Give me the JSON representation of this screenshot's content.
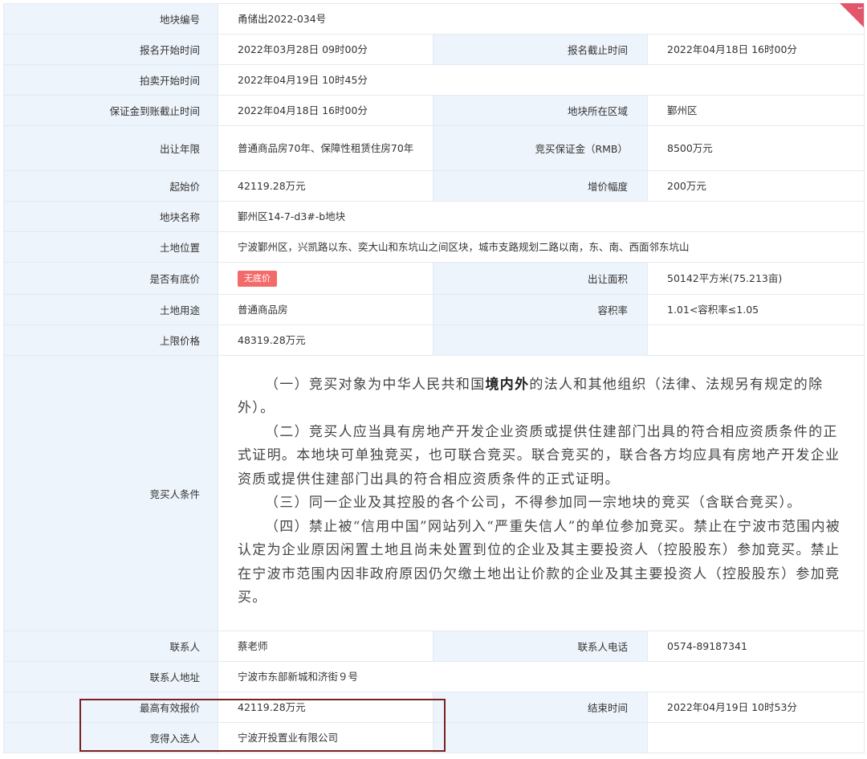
{
  "rows": {
    "parcel_no": {
      "label": "地块编号",
      "value": "甬储出2022-034号"
    },
    "reg_start": {
      "label": "报名开始时间",
      "value": "2022年03月28日 09时00分"
    },
    "reg_end": {
      "label": "报名截止时间",
      "value": "2022年04月18日 16时00分"
    },
    "auction_start": {
      "label": "拍卖开始时间",
      "value": "2022年04月19日 10时45分"
    },
    "deposit_deadline": {
      "label": "保证金到账截止时间",
      "value": "2022年04月18日 16时00分"
    },
    "district": {
      "label": "地块所在区域",
      "value": "鄞州区"
    },
    "term": {
      "label": "出让年限",
      "value": "普通商品房70年、保障性租赁住房70年"
    },
    "deposit": {
      "label": "竞买保证金（RMB）",
      "value": "8500万元"
    },
    "start_price": {
      "label": "起始价",
      "value": "42119.28万元"
    },
    "increment": {
      "label": "增价幅度",
      "value": "200万元"
    },
    "parcel_name": {
      "label": "地块名称",
      "value": "鄞州区14-7-d3#-b地块"
    },
    "location": {
      "label": "土地位置",
      "value": "宁波鄞州区，兴凯路以东、奕大山和东坑山之间区块，城市支路规划二路以南，东、南、西面邻东坑山"
    },
    "reserve": {
      "label": "是否有底价",
      "value": "无底价"
    },
    "area": {
      "label": "出让面积",
      "value": "50142平方米(75.213亩)"
    },
    "usage": {
      "label": "土地用途",
      "value": "普通商品房"
    },
    "far": {
      "label": "容积率",
      "value": "1.01<容积率≤1.05"
    },
    "cap": {
      "label": "上限价格",
      "value": "48319.28万元"
    },
    "contact": {
      "label": "联系人",
      "value": "蔡老师"
    },
    "phone": {
      "label": "联系人电话",
      "value": "0574-89187341"
    },
    "address": {
      "label": "联系人地址",
      "value": "宁波市东部新城和济街９号"
    },
    "top_bid": {
      "label": "最高有效报价",
      "value": "42119.28万元"
    },
    "end_time": {
      "label": "结束时间",
      "value": "2022年04月19日 10时53分"
    },
    "winner": {
      "label": "竞得入选人",
      "value": "宁波开投置业有限公司"
    }
  },
  "conditions": {
    "label": "竞买人条件",
    "p1_a": "（一）竞买对象为中华人民共和国",
    "p1_bold": "境内外",
    "p1_b": "的法人和其他组织（法律、法规另有规定的除外）。",
    "p2": "（二）竞买人应当具有房地产开发企业资质或提供住建部门出具的符合相应资质条件的正式证明。本地块可单独竞买，也可联合竞买。联合竞买的，联合各方均应具有房地产开发企业资质或提供住建部门出具的符合相应资质条件的正式证明。",
    "p3": "（三）同一企业及其控股的各个公司，不得参加同一宗地块的竞买（含联合竞买）。",
    "p4": "（四）禁止被“信用中国”网站列入“严重失信人”的单位参加竞买。禁止在宁波市范围内被认定为企业原因闲置土地且尚未处置到位的企业及其主要投资人（控股股东）参加竞买。禁止在宁波市范围内因非政府原因仍欠缴土地出让价款的企业及其主要投资人（控股股东）参加竞买。"
  },
  "colors": {
    "label_bg": "#eef4fb",
    "border": "#e3eaf2",
    "badge": "#f46a6a",
    "highlight": "#7a2020"
  }
}
